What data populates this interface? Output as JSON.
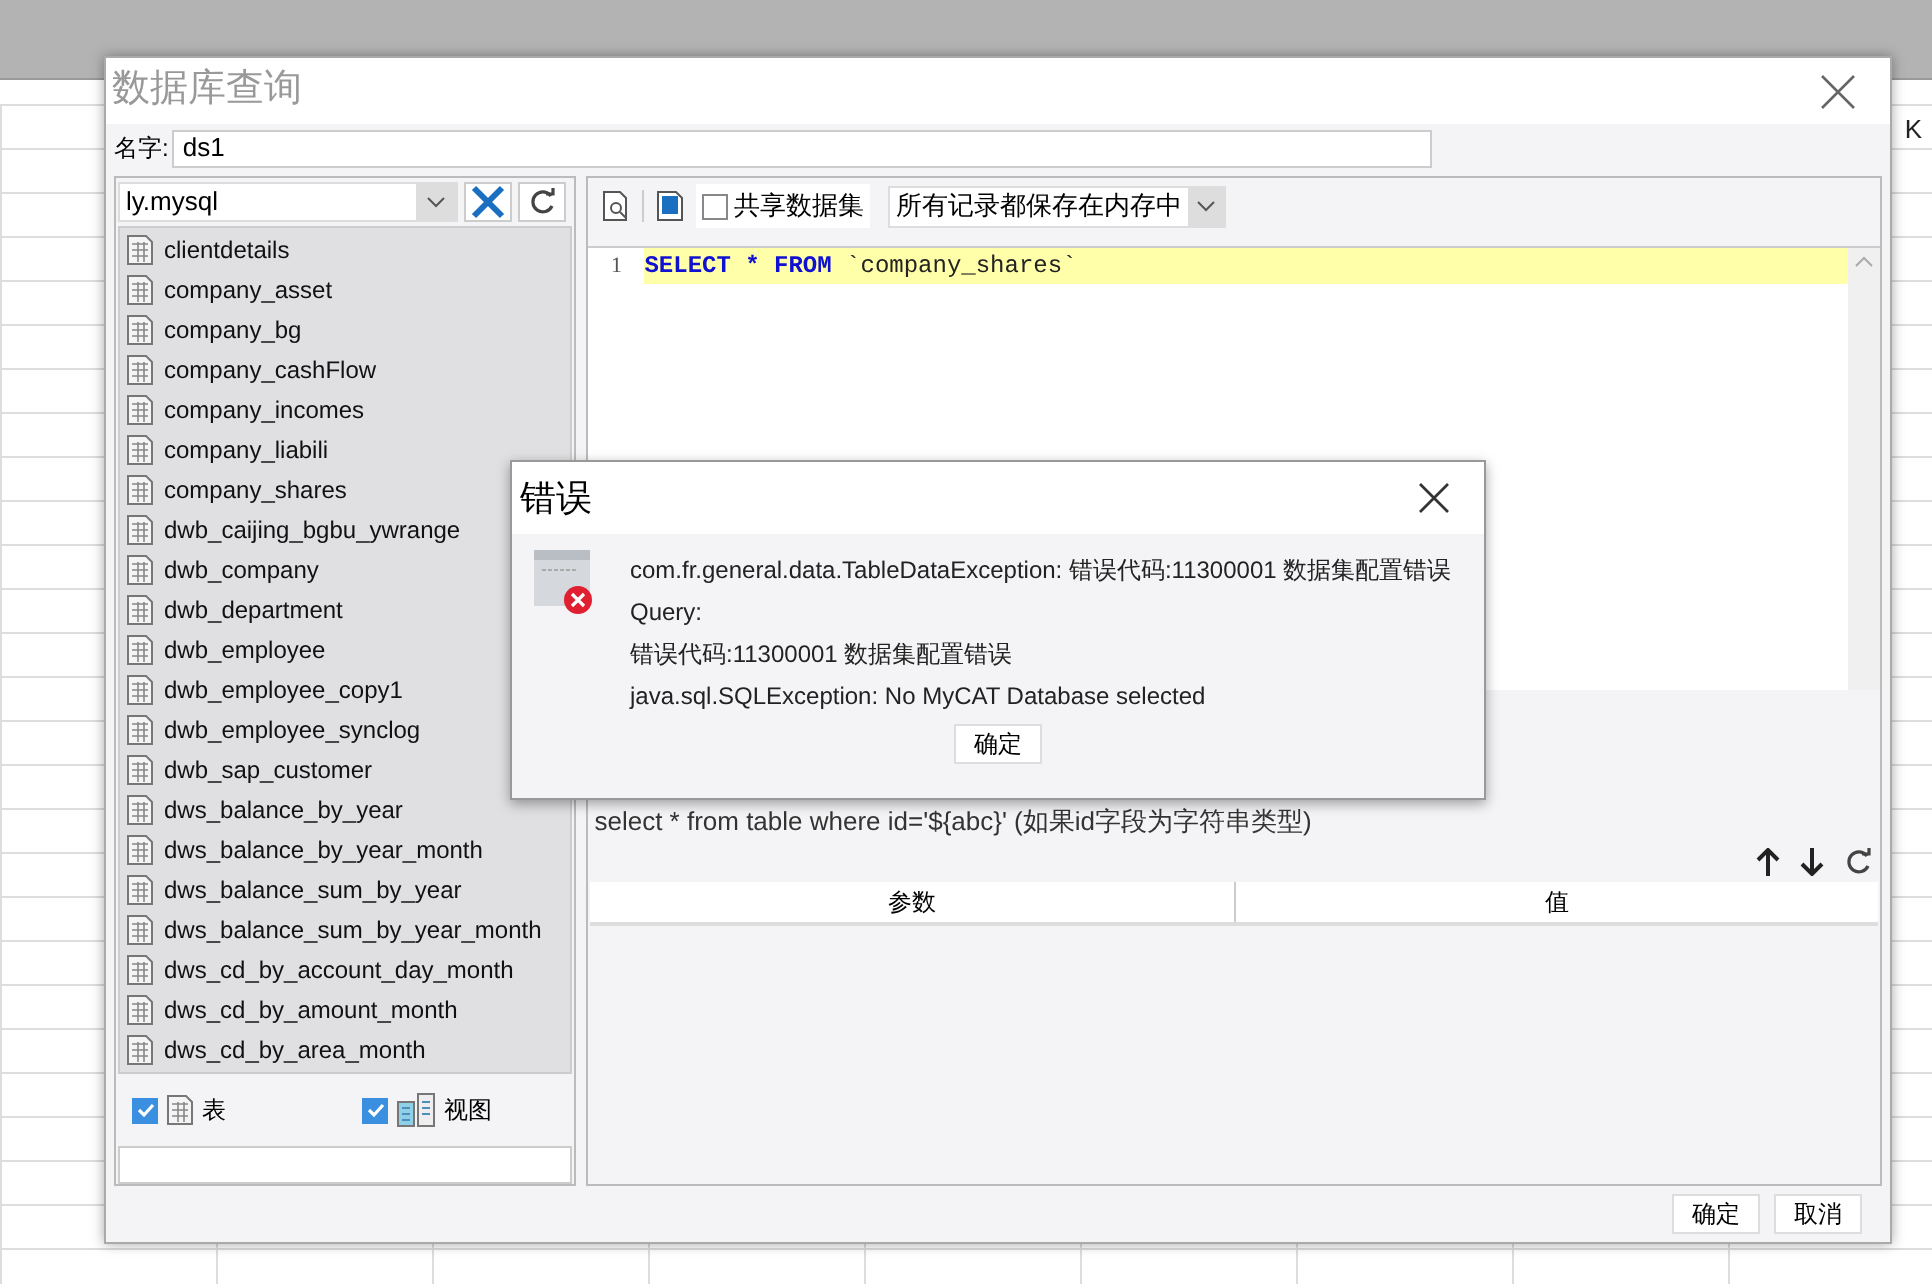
{
  "background": {
    "column_label": "K"
  },
  "window": {
    "title": "数据库查询"
  },
  "name_field": {
    "label": "名字:",
    "value": "ds1"
  },
  "connection": {
    "value": "ly.mysql"
  },
  "tables": [
    {
      "name": "clientdetails"
    },
    {
      "name": "company_asset"
    },
    {
      "name": "company_bg"
    },
    {
      "name": "company_cashFlow"
    },
    {
      "name": "company_incomes"
    },
    {
      "name": "company_liabili"
    },
    {
      "name": "company_shares"
    },
    {
      "name": "dwb_caijing_bgbu_ywrange"
    },
    {
      "name": "dwb_company"
    },
    {
      "name": "dwb_department"
    },
    {
      "name": "dwb_employee"
    },
    {
      "name": "dwb_employee_copy1"
    },
    {
      "name": "dwb_employee_synclog"
    },
    {
      "name": "dwb_sap_customer"
    },
    {
      "name": "dws_balance_by_year"
    },
    {
      "name": "dws_balance_by_year_month"
    },
    {
      "name": "dws_balance_sum_by_year"
    },
    {
      "name": "dws_balance_sum_by_year_month"
    },
    {
      "name": "dws_cd_by_account_day_month"
    },
    {
      "name": "dws_cd_by_amount_month"
    },
    {
      "name": "dws_cd_by_area_month"
    }
  ],
  "filters": [
    {
      "kind": "table",
      "label": "表",
      "checked": true
    },
    {
      "kind": "view",
      "label": "视图",
      "checked": true
    }
  ],
  "toolbar": {
    "shared_dataset": {
      "label": "共享数据集",
      "checked": false
    },
    "storage": "所有记录都保存在内存中"
  },
  "editor": {
    "lines": [
      {
        "number": "1",
        "tokens": [
          {
            "kind": "keyword",
            "text": "SELECT * FROM"
          },
          {
            "kind": "plain",
            "text": " `company_shares`"
          }
        ]
      }
    ]
  },
  "hint": "select * from table where id='${abc}' (如果id字段为字符串类型)",
  "params_table": {
    "columns": [
      "参数",
      "值"
    ]
  },
  "buttons": [
    "确定",
    "取消"
  ],
  "error_dialog": {
    "title": "错误",
    "lines": [
      "com.fr.general.data.TableDataException: 错误代码:11300001 数据集配置错误",
      "Query:",
      "错误代码:11300001 数据集配置错误",
      "java.sql.SQLException: No MyCAT Database selected"
    ],
    "button": "确定"
  }
}
